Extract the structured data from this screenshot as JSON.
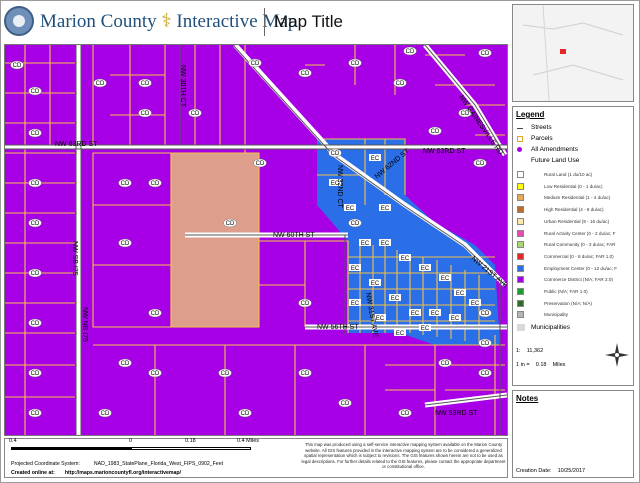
{
  "header": {
    "county_name": "Marion County",
    "app_name": "Interactive Map",
    "map_title": "Map Title"
  },
  "map": {
    "streets": [
      "NW 63RD ST",
      "NW 60TH ST",
      "NW 56TH ST",
      "NW 53RD ST",
      "NW 21ST AVE",
      "NW 31ST AVE",
      "NW 32ND CT",
      "NW 30TH CT",
      "NW 36TH AVE",
      "NW 62ND ST",
      "NW 58TH ST",
      "NW GAINESVILLE RD",
      "NW SB I75",
      "NW NB I75"
    ],
    "parcel_labels": {
      "cd": "CD",
      "ec": "EC"
    },
    "colors": {
      "commerce_district": "#a800e6",
      "employment_center": "#2a6fe8",
      "medium_residential": "#dd9f8b",
      "parcel_outline": "#f3c24a",
      "street": "#3c3c3c"
    }
  },
  "legend": {
    "title": "Legend",
    "layers": [
      {
        "label": "Streets",
        "icon": "line-icon"
      },
      {
        "label": "Parcels",
        "icon": "square-outline-icon"
      },
      {
        "label": "All Amendments",
        "icon": "dot-icon"
      },
      {
        "label": "Future Land Use",
        "icon": "none"
      }
    ],
    "land_use": [
      {
        "label": "Rural Land (1 du/10 ac)",
        "color": "#ffffff"
      },
      {
        "label": "Low Residential (0 - 1 du/ac)",
        "color": "#ffff00"
      },
      {
        "label": "Medium Residential (1 - 4 du/ac)",
        "color": "#e6a95a"
      },
      {
        "label": "High Residential (4 - 8 du/ac)",
        "color": "#c06a27"
      },
      {
        "label": "Urban Residential (8 - 16 du/ac)",
        "color": "#ffe8b0"
      },
      {
        "label": "Rural Activity Center (0 - 2 du/ac; F",
        "color": "#e64bb0"
      },
      {
        "label": "Rural Community (0 - 3 du/ac; FAR",
        "color": "#a7d86f"
      },
      {
        "label": "Commercial (0 - 8 du/ac; FAR 1.0)",
        "color": "#e8262a"
      },
      {
        "label": "Employment Center (0 - 12 du/ac; F",
        "color": "#2a6fe8"
      },
      {
        "label": "Commerce District (N/A; FAR 2.0)",
        "color": "#a800e6"
      },
      {
        "label": "Public (N/A; FAR 1.0)",
        "color": "#1e9c2f"
      },
      {
        "label": "Preservation (N/A; N/A)",
        "color": "#2d6b28"
      },
      {
        "label": "Municipality",
        "color": "#b5b5b5"
      }
    ],
    "municipalities": "Municipalities"
  },
  "scale": {
    "ratio_label": "1:",
    "ratio_value": "11,362",
    "inch_label": "1 in =",
    "inch_value": "0.18",
    "inch_unit": "Miles"
  },
  "notes": {
    "title": "Notes",
    "creation_label": "Creation Date:",
    "creation_date": "10/25/2017"
  },
  "footer": {
    "scalebar": {
      "left": "0.4",
      "mid": "0",
      "right_mid": "0.18",
      "right": "0.4 Miles"
    },
    "projection_label": "Projected Coordinate System:",
    "projection_value": "NAD_1983_StatePlane_Florida_West_FIPS_0902_Feet",
    "created_label": "Created online at:",
    "created_url": "http://maps.marioncountyfl.org/interactivemap/",
    "disclaimer": "This map was produced using a self-service interactive mapping system available on the Marion County website. All GIS features provided in the interactive mapping system are to be considered a generalized spatial representation which is subject to revisions. The GIS features shown herein are not to be used as legal descriptions. For further details related to the GIS features, please contact the appropriate department or constitutional office."
  }
}
